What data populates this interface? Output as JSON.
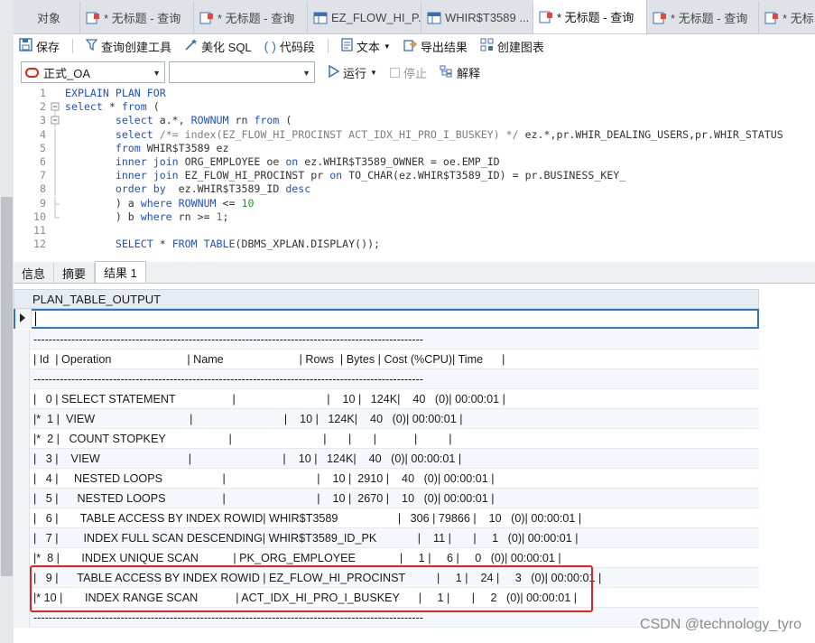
{
  "tabs": [
    {
      "label": "对象",
      "icon": "none"
    },
    {
      "label": "* 无标题 - 查询",
      "icon": "query-icon"
    },
    {
      "label": "* 无标题 - 查询",
      "icon": "query-icon"
    },
    {
      "label": "EZ_FLOW_HI_P...",
      "icon": "table-icon"
    },
    {
      "label": "WHIR$T3589 ...",
      "icon": "table-icon"
    },
    {
      "label": "* 无标题 - 查询",
      "icon": "query-icon",
      "active": true
    },
    {
      "label": "* 无标题 - 查询",
      "icon": "query-icon"
    },
    {
      "label": "* 无标",
      "icon": "query-icon"
    }
  ],
  "toolbar": {
    "save": "保存",
    "query_builder": "查询创建工具",
    "beautify": "美化 SQL",
    "snippet": "代码段",
    "text": "文本",
    "export": "导出结果",
    "chart": "创建图表"
  },
  "connection": {
    "selected": "正式_OA",
    "database": "",
    "run": "运行",
    "stop": "停止",
    "explain": "解释"
  },
  "editor": {
    "line_numbers": [
      "1",
      "2",
      "3",
      "4",
      "5",
      "6",
      "7",
      "8",
      "9",
      "10",
      "11",
      "12"
    ]
  },
  "results": {
    "tabs": [
      "信息",
      "摘要",
      "结果 1"
    ],
    "active_tab": "结果 1",
    "column": "PLAN_TABLE_OUTPUT",
    "rows": [
      "",
      "-------------------------------------------------------------------------------------------------------",
      "| Id  | Operation                        | Name                        | Rows  | Bytes | Cost (%CPU)| Time      |",
      "-------------------------------------------------------------------------------------------------------",
      "|   0 | SELECT STATEMENT                  |                             |    10 |   124K|    40   (0)| 00:00:01 |",
      "|*  1 |  VIEW                              |                             |    10 |   124K|    40   (0)| 00:00:01 |",
      "|*  2 |   COUNT STOPKEY                    |                             |       |       |            |          |",
      "|   3 |    VIEW                            |                             |    10 |   124K|    40   (0)| 00:00:01 |",
      "|   4 |     NESTED LOOPS                   |                             |    10 |  2910 |    40   (0)| 00:00:01 |",
      "|   5 |      NESTED LOOPS                  |                             |    10 |  2670 |    10   (0)| 00:00:01 |",
      "|   6 |       TABLE ACCESS BY INDEX ROWID| WHIR$T3589                   |   306 | 79866 |    10   (0)| 00:00:01 |",
      "|   7 |        INDEX FULL SCAN DESCENDING| WHIR$T3589_ID_PK             |    11 |       |     1   (0)| 00:00:01 |",
      "|*  8 |       INDEX UNIQUE SCAN           | PK_ORG_EMPLOYEE              |     1 |     6 |     0   (0)| 00:00:01 |",
      "|   9 |      TABLE ACCESS BY INDEX ROWID | EZ_FLOW_HI_PROCINST          |     1 |    24 |     3   (0)| 00:00:01 |",
      "|* 10 |       INDEX RANGE SCAN            | ACT_IDX_HI_PRO_I_BUSKEY      |     1 |       |     2   (0)| 00:00:01 |",
      "-------------------------------------------------------------------------------------------------------"
    ]
  },
  "watermark": "CSDN @technology_tyro",
  "colors": {
    "highlight": "#e02424",
    "selection": "#2c75c7",
    "keyword": "#1e50c8",
    "number": "#1aa01a"
  }
}
